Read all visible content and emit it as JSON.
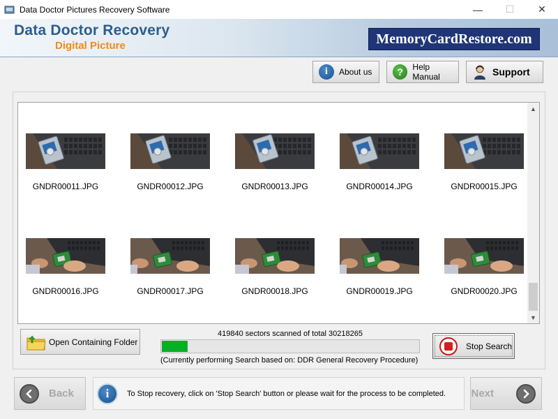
{
  "window": {
    "title": "Data Doctor Pictures Recovery Software",
    "controls": {
      "minimize": "—",
      "maximize": "☐",
      "close": "✕"
    }
  },
  "banner": {
    "brand_line1": "Data Doctor Recovery",
    "brand_line2": "Digital Picture",
    "logo_text": "MemoryCardRestore.com"
  },
  "toolbar": {
    "about": {
      "label": "About us",
      "icon": "info-icon"
    },
    "help": {
      "label": "Help Manual",
      "icon": "help-icon"
    },
    "support": {
      "label": "Support",
      "icon": "support-person-icon"
    }
  },
  "gallery": {
    "items": [
      {
        "name": "GNDR00011.JPG",
        "scene": "hdd-laptop"
      },
      {
        "name": "GNDR00012.JPG",
        "scene": "hdd-laptop"
      },
      {
        "name": "GNDR00013.JPG",
        "scene": "hdd-laptop"
      },
      {
        "name": "GNDR00014.JPG",
        "scene": "hdd-laptop"
      },
      {
        "name": "GNDR00015.JPG",
        "scene": "hdd-laptop"
      },
      {
        "name": "GNDR00016.JPG",
        "scene": "hands-drive"
      },
      {
        "name": "GNDR00017.JPG",
        "scene": "hands-drive"
      },
      {
        "name": "GNDR00018.JPG",
        "scene": "hands-drive"
      },
      {
        "name": "GNDR00019.JPG",
        "scene": "hands-drive"
      },
      {
        "name": "GNDR00020.JPG",
        "scene": "hands-drive"
      }
    ]
  },
  "actions": {
    "open_folder_label": "Open Containing Folder",
    "stop_search_label": "Stop Search"
  },
  "progress": {
    "scan_status": "419840 sectors scanned of total 30218265",
    "fraction": 0.1,
    "procedure_text": "(Currently performing Search based on:  DDR General Recovery Procedure)"
  },
  "footer": {
    "back_label": "Back",
    "next_label": "Next",
    "info_text": "To Stop recovery, click on 'Stop Search' button or please wait for the process to be completed."
  },
  "colors": {
    "brand_blue": "#2e5d8e",
    "brand_orange": "#f08a1c",
    "logo_bg": "#1f3577",
    "progress_green": "#06b025",
    "stop_red": "#d21f1f"
  }
}
